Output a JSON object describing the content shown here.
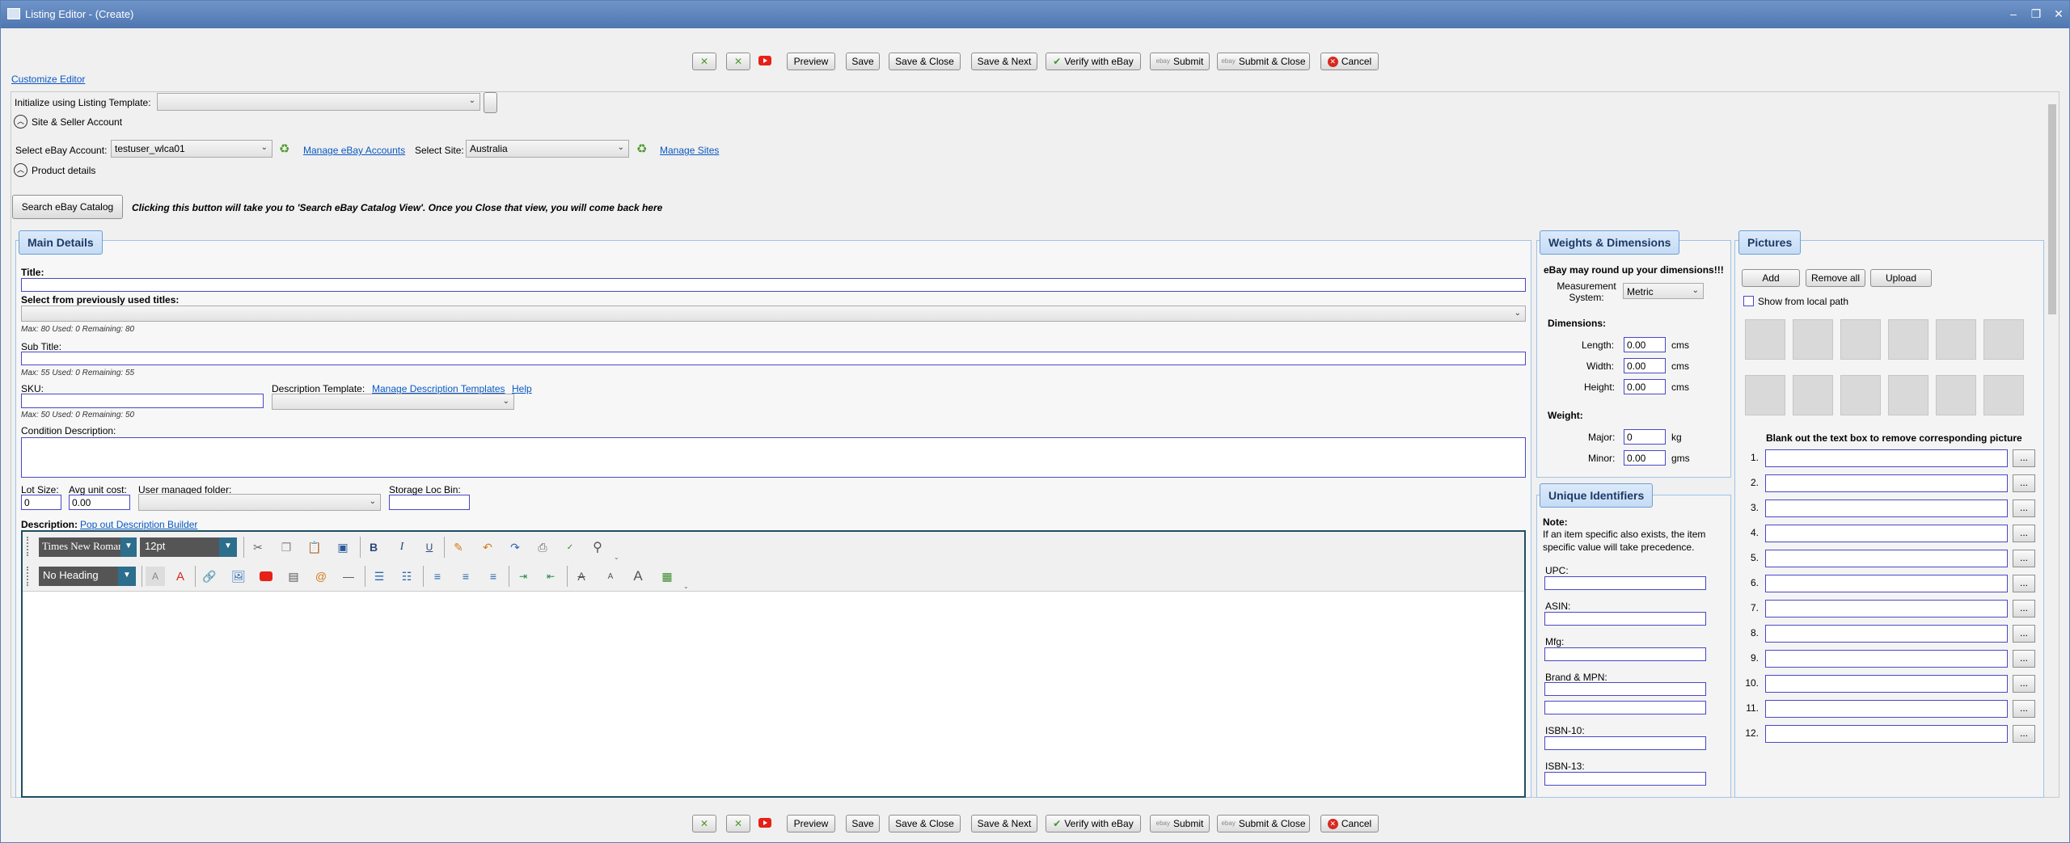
{
  "window": {
    "title": "Listing Editor - (Create)",
    "minimize": "‒",
    "restore": "❐",
    "close": "✕"
  },
  "toolbar": {
    "preview": "Preview",
    "save": "Save",
    "save_close": "Save & Close",
    "save_next": "Save & Next",
    "verify": "Verify with eBay",
    "submit": "Submit",
    "submit_close": "Submit & Close",
    "cancel": "Cancel"
  },
  "customize_editor": "Customize Editor",
  "init_template_label": "Initialize using Listing Template:",
  "site_seller": {
    "header": "Site & Seller Account",
    "account_label": "Select eBay Account:",
    "account_value": "testuser_wlca01",
    "manage_accounts": "Manage eBay Accounts",
    "site_label": "Select Site:",
    "site_value": "Australia",
    "manage_sites": "Manage Sites"
  },
  "product": {
    "header": "Product details",
    "search_catalog": "Search eBay Catalog",
    "search_note": "Clicking this button will take you to 'Search eBay Catalog View'. Once you Close that view, you will come back here"
  },
  "main": {
    "title": "Main Details",
    "title_label": "Title:",
    "prev_titles_label": "Select from previously used titles:",
    "title_counter": "Max: 80 Used: 0 Remaining: 80",
    "subtitle_label": "Sub Title:",
    "subtitle_counter": "Max: 55 Used: 0 Remaining: 55",
    "sku_label": "SKU:",
    "sku_counter": "Max: 50 Used: 0 Remaining: 50",
    "desc_template_label": "Description Template:",
    "manage_templates": "Manage Description Templates",
    "help": "Help",
    "condition_label": "Condition Description:",
    "lot_label": "Lot Size:",
    "lot_value": "0",
    "avg_label": "Avg unit cost:",
    "avg_value": "0.00",
    "folder_label": "User managed folder:",
    "storage_label": "Storage Loc Bin:",
    "description_label": "Description:",
    "popout": "Pop out Description Builder"
  },
  "editor": {
    "font": "Times New Roman",
    "size": "12pt",
    "heading": "No Heading"
  },
  "weights": {
    "title": "Weights & Dimensions",
    "warning": "eBay may round up your dimensions!!!",
    "measure_label": "Measurement System:",
    "measure_value": "Metric",
    "dimensions_label": "Dimensions:",
    "length_label": "Length:",
    "length_value": "0.00",
    "width_label": "Width:",
    "width_value": "0.00",
    "height_label": "Height:",
    "height_value": "0.00",
    "cms": "cms",
    "weight_label": "Weight:",
    "major_label": "Major:",
    "major_value": "0",
    "kg": "kg",
    "minor_label": "Minor:",
    "minor_value": "0.00",
    "gms": "gms"
  },
  "identifiers": {
    "title": "Unique Identifiers",
    "note_label": "Note:",
    "note_text": "If an item specific also exists, the item specific value will take precedence.",
    "upc": "UPC:",
    "asin": "ASIN:",
    "mfg": "Mfg:",
    "brand_mpn": "Brand & MPN:",
    "isbn10": "ISBN-10:",
    "isbn13": "ISBN-13:"
  },
  "pictures": {
    "title": "Pictures",
    "add": "Add",
    "remove_all": "Remove all",
    "upload": "Upload",
    "show_local": "Show from local path",
    "blank_note": "Blank out the text box to remove corresponding picture",
    "rows": [
      "1.",
      "2.",
      "3.",
      "4.",
      "5.",
      "6.",
      "7.",
      "8.",
      "9.",
      "10.",
      "11.",
      "12."
    ],
    "browse": "..."
  },
  "colors": {
    "titlebar": "#5a82ba",
    "accent": "#4848c8",
    "link": "#0a58c2",
    "panel_border": "#9fc3e8"
  }
}
